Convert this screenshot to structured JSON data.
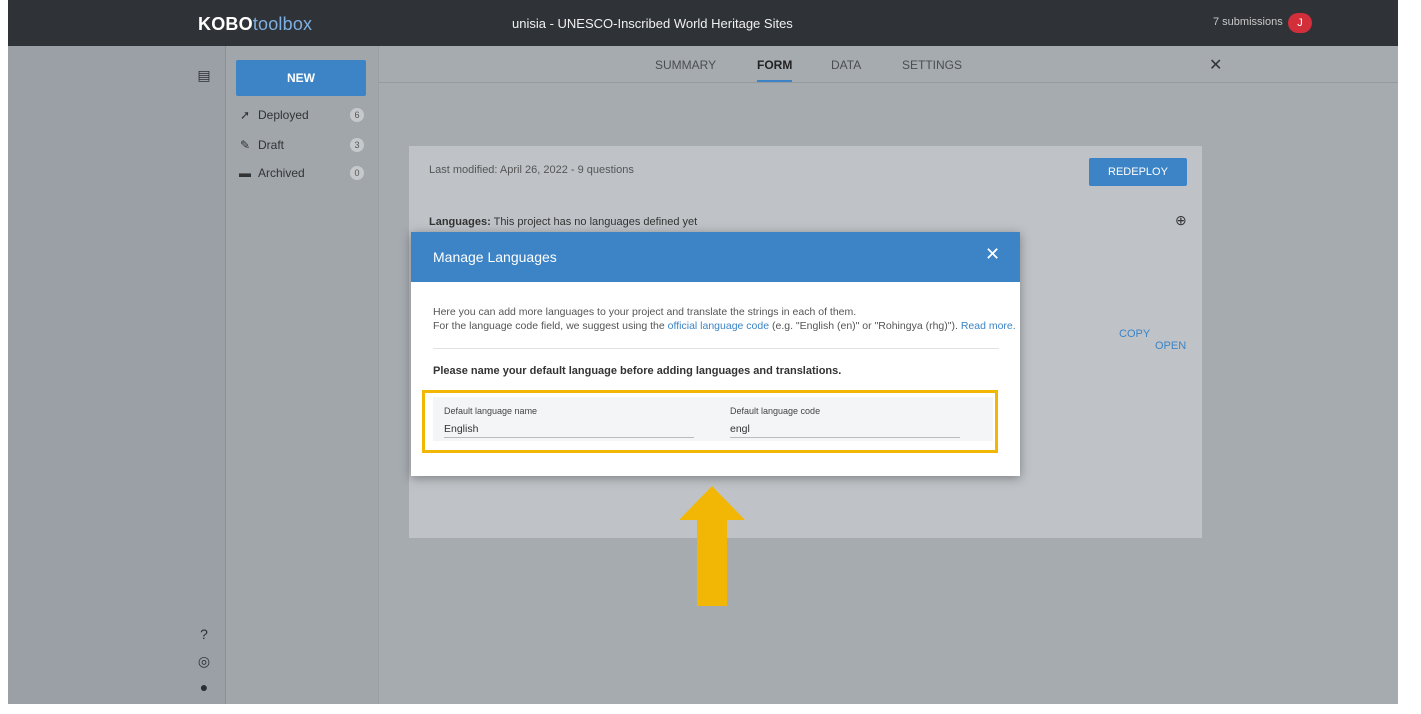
{
  "header": {
    "logo_prefix": "KOBO",
    "logo_suffix": "toolbox",
    "project_title": "unisia - UNESCO-Inscribed World Heritage Sites",
    "submissions": "7 submissions",
    "avatar_letter": "J"
  },
  "sidebar": {
    "new_label": "NEW",
    "items": [
      {
        "label": "Deployed",
        "count": "6"
      },
      {
        "label": "Draft",
        "count": "3"
      },
      {
        "label": "Archived",
        "count": "0"
      }
    ]
  },
  "tabs": [
    "SUMMARY",
    "FORM",
    "DATA",
    "SETTINGS"
  ],
  "active_tab": "FORM",
  "form_card": {
    "last_modified": "Last modified: April 26, 2022 - 9 questions",
    "redeploy_label": "REDEPLOY",
    "languages_label": "Languages:",
    "languages_text": "This project has no languages defined yet",
    "copy_label": "COPY",
    "open_label": "OPEN"
  },
  "modal": {
    "title": "Manage Languages",
    "intro_line1_a": "Here you can add more languages to your project",
    "intro_line1_b": "and translate the strings in each of them.",
    "intro_line2_a": "For the language code field, we suggest using the",
    "intro_line2_link": "official language code",
    "intro_line2_b": "(e.g. \"English (en)\" or \"Rohingya (rhg)\").",
    "intro_line2_more": "Read more.",
    "instruction": "Please name your default language before adding languages and translations.",
    "default_name_label": "Default language name",
    "default_name_value": "English",
    "default_code_label": "Default language code",
    "default_code_value": "engl"
  },
  "colors": {
    "accent": "#3c84c6",
    "highlight": "#f2b705"
  }
}
